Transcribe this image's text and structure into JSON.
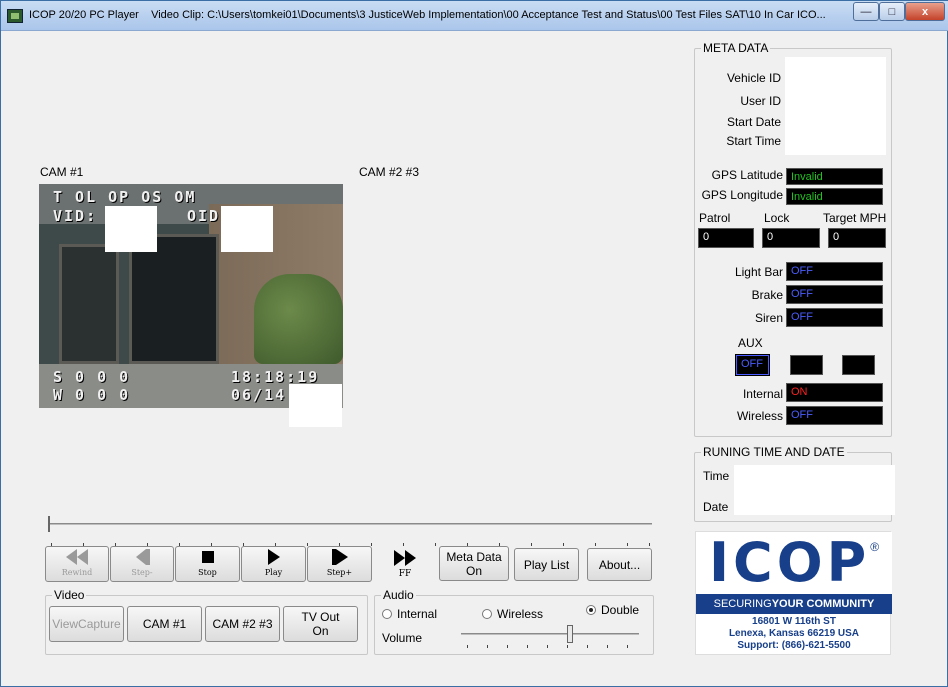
{
  "window": {
    "app_title": "ICOP 20/20 PC Player",
    "clip_title": "Video Clip: C:\\Users\\tomkei01\\Documents\\3 JusticeWeb Implementation\\00 Acceptance Test and Status\\00 Test Files SAT\\10 In Car ICO...",
    "minimize": "—",
    "maximize": "□",
    "close": "x"
  },
  "cameras": {
    "cam1_label": "CAM #1",
    "cam23_label": "CAM #2 #3",
    "osd_line1": "T  OL  OP  OS  OM",
    "osd_vid": "VID:",
    "osd_oid": "OID:",
    "osd_line3a": "S  0  0  0",
    "osd_line3b": "18:18:19",
    "osd_line4a": "W  0  0  0",
    "osd_line4b": "06/14"
  },
  "metadata": {
    "title": "META DATA",
    "vehicle_id": "Vehicle ID",
    "user_id": "User ID",
    "start_date": "Start Date",
    "start_time": "Start Time",
    "gps_lat_label": "GPS Latitude",
    "gps_lat_value": "Invalid",
    "gps_lon_label": "GPS Longitude",
    "gps_lon_value": "Invalid",
    "patrol_label": "Patrol",
    "lock_label": "Lock",
    "target_label": "Target MPH",
    "patrol_value": "0",
    "lock_value": "0",
    "target_value": "0",
    "lightbar_label": "Light Bar",
    "lightbar_value": "OFF",
    "brake_label": "Brake",
    "brake_value": "OFF",
    "siren_label": "Siren",
    "siren_value": "OFF",
    "aux_label": "AUX",
    "aux1_value": "OFF",
    "internal_label": "Internal",
    "internal_value": "ON",
    "wireless_label": "Wireless",
    "wireless_value": "OFF"
  },
  "running": {
    "title": "RUNING TIME AND DATE",
    "time_label": "Time",
    "date_label": "Date"
  },
  "transport": {
    "rewind": "Rewind",
    "step_back": "Step-",
    "stop": "Stop",
    "play": "Play",
    "step_fwd": "Step+",
    "ff": "FF",
    "meta_data_line1": "Meta Data",
    "meta_data_line2": "On",
    "play_list": "Play List",
    "about": "About..."
  },
  "video_group": {
    "title": "Video",
    "view_capture": "ViewCapture",
    "cam1": "CAM #1",
    "cam23": "CAM #2 #3",
    "tvout_line1": "TV Out",
    "tvout_line2": "On"
  },
  "audio_group": {
    "title": "Audio",
    "internal": "Internal",
    "wireless": "Wireless",
    "double": "Double",
    "selected": "Double",
    "volume_label": "Volume"
  },
  "logo": {
    "word": "ICOP",
    "reg": "®",
    "tagline_a": "SECURING ",
    "tagline_b": "YOUR COMMUNITY",
    "address1": "16801 W 116th ST",
    "address2": "Lenexa, Kansas  66219 USA",
    "support": "Support: (866)-621-5500"
  },
  "colors": {
    "green_text": "#22c322",
    "blue_text": "#4a5cff",
    "red_text": "#ff2020",
    "brand_blue": "#173f8a"
  }
}
